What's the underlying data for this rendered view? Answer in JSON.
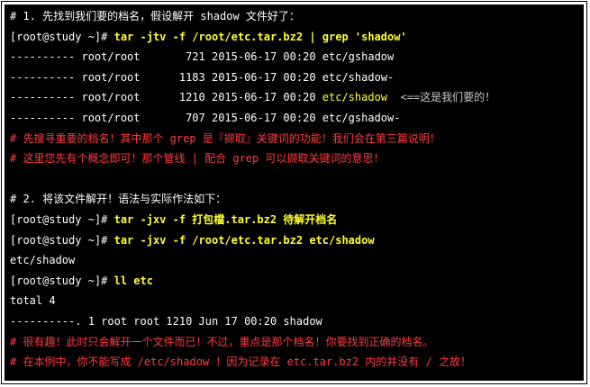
{
  "colors": {
    "background": "#000000",
    "text": "#ffffff",
    "command": "#ffff33",
    "comment": "#ff3c3c",
    "border": "#000000"
  },
  "lines": [
    {
      "segments": [
        {
          "text": "# 1. 先找到我们要的档名，假设解开 shadow 文件好了：",
          "style": "white"
        }
      ]
    },
    {
      "segments": [
        {
          "text": "[root@study ~]# ",
          "style": "white"
        },
        {
          "text": "tar -jtv -f /root/etc.tar.bz2 | grep 'shadow'",
          "style": "yellow"
        }
      ]
    },
    {
      "segments": [
        {
          "text": "---------- root/root       721 2015-06-17 00:20 etc/gshadow",
          "style": "white"
        }
      ]
    },
    {
      "segments": [
        {
          "text": "---------- root/root      1183 2015-06-17 00:20 etc/shadow-",
          "style": "white"
        }
      ]
    },
    {
      "segments": [
        {
          "text": "---------- root/root      1210 2015-06-17 00:20 ",
          "style": "white"
        },
        {
          "text": "etc/shadow",
          "style": "file"
        },
        {
          "text": "  <==这是我们要的！",
          "style": "note"
        }
      ]
    },
    {
      "segments": [
        {
          "text": "---------- root/root       707 2015-06-17 00:20 etc/gshadow-",
          "style": "white"
        }
      ]
    },
    {
      "segments": [
        {
          "text": "# 先搜寻重要的档名！其中那个 grep 是『撷取』关键词的功能！我们会在第三篇说明！",
          "style": "red"
        }
      ]
    },
    {
      "segments": [
        {
          "text": "# 这里您先有个概念即可！那个管线 | 配合 grep 可以撷取关键词的意思！",
          "style": "red"
        }
      ]
    },
    {
      "segments": [
        {
          "text": "",
          "style": "white"
        }
      ]
    },
    {
      "segments": [
        {
          "text": "# 2. 将该文件解开！语法与实际作法如下：",
          "style": "white"
        }
      ]
    },
    {
      "segments": [
        {
          "text": "[root@study ~]# ",
          "style": "white"
        },
        {
          "text": "tar -jxv -f 打包檔.tar.bz2 待解开档名",
          "style": "yellow"
        }
      ]
    },
    {
      "segments": [
        {
          "text": "[root@study ~]# ",
          "style": "white"
        },
        {
          "text": "tar -jxv -f /root/etc.tar.bz2 etc/shadow",
          "style": "yellow"
        }
      ]
    },
    {
      "segments": [
        {
          "text": "etc/shadow",
          "style": "white"
        }
      ]
    },
    {
      "segments": [
        {
          "text": "[root@study ~]# ",
          "style": "white"
        },
        {
          "text": "ll etc",
          "style": "yellow"
        }
      ]
    },
    {
      "segments": [
        {
          "text": "total 4",
          "style": "white"
        }
      ]
    },
    {
      "segments": [
        {
          "text": "----------. 1 root root 1210 Jun 17 00:20 shadow",
          "style": "white"
        }
      ]
    },
    {
      "segments": [
        {
          "text": "# 很有趣！此时只会解开一个文件而已！不过，重点是那个档名！你要找到正确的档名。",
          "style": "red"
        }
      ]
    },
    {
      "segments": [
        {
          "text": "# 在本例中，你不能写成 /etc/shadow ！因为记录在 etc.tar.bz2 内的并没有 / 之故！",
          "style": "red"
        }
      ]
    }
  ]
}
